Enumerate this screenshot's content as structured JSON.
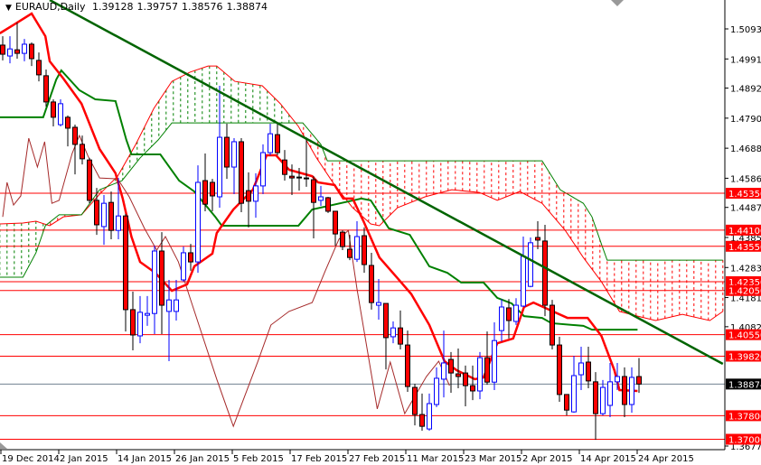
{
  "header": {
    "menu_icon": "triangle-down-icon",
    "symbol": "EURAUD,Daily",
    "open": "1.39128",
    "high": "1.39757",
    "low": "1.38576",
    "close": "1.38874"
  },
  "colors": {
    "bull": "#0000ff",
    "bear": "#ff0000",
    "tenkan": "#ff0000",
    "kijun": "#008000",
    "chikou": "#a52a2a",
    "level": "#ff0000",
    "trendline": "#006400",
    "current": "#708090"
  },
  "chart_data": {
    "type": "candlestick",
    "title": "EURAUD,Daily",
    "x_ticks": [
      {
        "bar": 0,
        "label": "19 Dec 2014"
      },
      {
        "bar": 8,
        "label": "2 Jan 2015"
      },
      {
        "bar": 16,
        "label": "14 Jan 2015"
      },
      {
        "bar": 24,
        "label": "26 Jan 2015"
      },
      {
        "bar": 32,
        "label": "5 Feb 2015"
      },
      {
        "bar": 40,
        "label": "17 Feb 2015"
      },
      {
        "bar": 48,
        "label": "27 Feb 2015"
      },
      {
        "bar": 56,
        "label": "11 Mar 2015"
      },
      {
        "bar": 64,
        "label": "23 Mar 2015"
      },
      {
        "bar": 72,
        "label": "2 Apr 2015"
      },
      {
        "bar": 80,
        "label": "14 Apr 2015"
      },
      {
        "bar": 88,
        "label": "24 Apr 2015"
      }
    ],
    "y_ticks": [
      "1.50930",
      "1.49910",
      "1.48920",
      "1.47900",
      "1.46880",
      "1.45860",
      "1.44870",
      "1.43850",
      "1.42830",
      "1.41810",
      "1.40820",
      "1.36770"
    ],
    "ylim": [
      1.3677,
      1.5093
    ],
    "levels": [
      "1.45350",
      "1.44100",
      "1.43550",
      "1.42350",
      "1.42050",
      "1.40550",
      "1.39820",
      "1.37800",
      "1.37000"
    ],
    "current_price": "1.38874",
    "candles": [
      [
        1.5038,
        1.5068,
        1.4986,
        1.5007
      ],
      [
        1.5001,
        1.5068,
        1.4976,
        1.5025
      ],
      [
        1.5022,
        1.5114,
        1.4992,
        1.501
      ],
      [
        1.501,
        1.5059,
        1.4983,
        1.5041
      ],
      [
        1.5041,
        1.5047,
        1.4967,
        1.4992
      ],
      [
        1.4986,
        1.5013,
        1.4915,
        1.4937
      ],
      [
        1.4934,
        1.4955,
        1.4829,
        1.4845
      ],
      [
        1.4845,
        1.4854,
        1.4762,
        1.4793
      ],
      [
        1.4768,
        1.4854,
        1.4762,
        1.4839
      ],
      [
        1.4793,
        1.4799,
        1.4694,
        1.4756
      ],
      [
        1.4759,
        1.4768,
        1.4599,
        1.4701
      ],
      [
        1.4701,
        1.4731,
        1.4633,
        1.4652
      ],
      [
        1.4648,
        1.4655,
        1.4501,
        1.4511
      ],
      [
        1.4511,
        1.4553,
        1.4394,
        1.4428
      ],
      [
        1.4422,
        1.4529,
        1.436,
        1.4501
      ],
      [
        1.4504,
        1.4541,
        1.4379,
        1.4409
      ],
      [
        1.4409,
        1.4587,
        1.4379,
        1.4458
      ],
      [
        1.4458,
        1.4465,
        1.4066,
        1.414
      ],
      [
        1.414,
        1.4201,
        1.4002,
        1.4054
      ],
      [
        1.4051,
        1.4186,
        1.4026,
        1.4131
      ],
      [
        1.4121,
        1.4186,
        1.4085,
        1.4127
      ],
      [
        1.4127,
        1.4357,
        1.4057,
        1.4339
      ],
      [
        1.4339,
        1.4403,
        1.4057,
        1.4155
      ],
      [
        1.4134,
        1.4241,
        1.3965,
        1.4173
      ],
      [
        1.4134,
        1.4241,
        1.4103,
        1.4173
      ],
      [
        1.4241,
        1.4354,
        1.4235,
        1.4333
      ],
      [
        1.4333,
        1.4363,
        1.4272,
        1.4302
      ],
      [
        1.4302,
        1.463,
        1.4265,
        1.4572
      ],
      [
        1.4578,
        1.467,
        1.4474,
        1.4498
      ],
      [
        1.4572,
        1.4584,
        1.4474,
        1.4526
      ],
      [
        1.4523,
        1.49,
        1.4486,
        1.4725
      ],
      [
        1.4725,
        1.4771,
        1.4584,
        1.4624
      ],
      [
        1.4624,
        1.4722,
        1.4532,
        1.471
      ],
      [
        1.471,
        1.4722,
        1.4471,
        1.4501
      ],
      [
        1.4544,
        1.4606,
        1.4419,
        1.4508
      ],
      [
        1.4508,
        1.4603,
        1.4452,
        1.456
      ],
      [
        1.456,
        1.4701,
        1.4532,
        1.4673
      ],
      [
        1.4673,
        1.4771,
        1.4664,
        1.4737
      ],
      [
        1.4734,
        1.4771,
        1.4664,
        1.4673
      ],
      [
        1.4648,
        1.4682,
        1.4578,
        1.4599
      ],
      [
        1.4593,
        1.4633,
        1.4529,
        1.4587
      ],
      [
        1.459,
        1.4621,
        1.4544,
        1.4587
      ],
      [
        1.4587,
        1.4725,
        1.4557,
        1.4584
      ],
      [
        1.4581,
        1.4593,
        1.4382,
        1.4504
      ],
      [
        1.4511,
        1.456,
        1.4492,
        1.4523
      ],
      [
        1.452,
        1.4523,
        1.4468,
        1.4474
      ],
      [
        1.4474,
        1.4474,
        1.4357,
        1.4397
      ],
      [
        1.4403,
        1.4409,
        1.4342,
        1.4354
      ],
      [
        1.4345,
        1.4394,
        1.4308,
        1.4317
      ],
      [
        1.4311,
        1.444,
        1.4302,
        1.4388
      ],
      [
        1.4391,
        1.4419,
        1.4265,
        1.4293
      ],
      [
        1.429,
        1.4333,
        1.414,
        1.4164
      ],
      [
        1.4155,
        1.4244,
        1.4106,
        1.4164
      ],
      [
        1.4161,
        1.4161,
        1.3937,
        1.4045
      ],
      [
        1.4048,
        1.41,
        1.4026,
        1.4078
      ],
      [
        1.4078,
        1.4137,
        1.4005,
        1.4023
      ],
      [
        1.402,
        1.4069,
        1.3861,
        1.3879
      ],
      [
        1.3876,
        1.3888,
        1.3747,
        1.3784
      ],
      [
        1.3784,
        1.3855,
        1.3729,
        1.3744
      ],
      [
        1.3735,
        1.3855,
        1.3729,
        1.3821
      ],
      [
        1.3818,
        1.3944,
        1.3809,
        1.3907
      ],
      [
        1.3904,
        1.4069,
        1.3842,
        1.3959
      ],
      [
        1.3971,
        1.3996,
        1.3858,
        1.3925
      ],
      [
        1.3922,
        1.4008,
        1.3873,
        1.3913
      ],
      [
        1.3925,
        1.395,
        1.3812,
        1.3882
      ],
      [
        1.3882,
        1.395,
        1.3833,
        1.3864
      ],
      [
        1.3864,
        1.3996,
        1.3836,
        1.3977
      ],
      [
        1.3977,
        1.4066,
        1.3885,
        1.3894
      ],
      [
        1.3894,
        1.4097,
        1.3867,
        1.4035
      ],
      [
        1.4069,
        1.4176,
        1.4032,
        1.4149
      ],
      [
        1.4146,
        1.4176,
        1.4042,
        1.4103
      ],
      [
        1.41,
        1.4179,
        1.4088,
        1.4155
      ],
      [
        1.4152,
        1.4388,
        1.4149,
        1.4321
      ],
      [
        1.4219,
        1.4385,
        1.4216,
        1.4367
      ],
      [
        1.4385,
        1.444,
        1.4345,
        1.4376
      ],
      [
        1.4373,
        1.4428,
        1.4118,
        1.4155
      ],
      [
        1.4155,
        1.4173,
        1.4005,
        1.402
      ],
      [
        1.402,
        1.4048,
        1.3827,
        1.3852
      ],
      [
        1.3852,
        1.3852,
        1.3781,
        1.3799
      ],
      [
        1.3793,
        1.3983,
        1.379,
        1.3916
      ],
      [
        1.3919,
        1.4014,
        1.3867,
        1.3959
      ],
      [
        1.3962,
        1.4014,
        1.3873,
        1.3898
      ],
      [
        1.3895,
        1.3928,
        1.3698,
        1.3787
      ],
      [
        1.3787,
        1.3901,
        1.3781,
        1.3876
      ],
      [
        1.3815,
        1.3959,
        1.3775,
        1.3895
      ],
      [
        1.3895,
        1.3959,
        1.3867,
        1.3913
      ],
      [
        1.3913,
        1.3944,
        1.3775,
        1.3818
      ],
      [
        1.3818,
        1.3944,
        1.379,
        1.391
      ],
      [
        1.39128,
        1.39757,
        1.38576,
        1.38874
      ]
    ],
    "ichimoku": {
      "tenkan": [
        [
          -0.4,
          1.5078
        ],
        [
          1.6,
          1.5108
        ],
        [
          4,
          1.5145
        ],
        [
          5.9,
          1.5068
        ],
        [
          6.5,
          1.4983
        ],
        [
          8.4,
          1.4924
        ],
        [
          10.9,
          1.4839
        ],
        [
          13.4,
          1.4685
        ],
        [
          15.6,
          1.4603
        ],
        [
          16.6,
          1.4517
        ],
        [
          17.8,
          1.4388
        ],
        [
          19,
          1.4302
        ],
        [
          21.1,
          1.4265
        ],
        [
          23.4,
          1.4204
        ],
        [
          25.5,
          1.4226
        ],
        [
          26.5,
          1.4287
        ],
        [
          29,
          1.433
        ],
        [
          29.6,
          1.44
        ],
        [
          31.9,
          1.448
        ],
        [
          34.6,
          1.4547
        ],
        [
          36.5,
          1.4664
        ],
        [
          37.8,
          1.4664
        ],
        [
          39.6,
          1.4615
        ],
        [
          42.8,
          1.4593
        ],
        [
          43.6,
          1.4572
        ],
        [
          45.9,
          1.4563
        ],
        [
          47.1,
          1.4517
        ],
        [
          48.4,
          1.4517
        ],
        [
          49.9,
          1.444
        ],
        [
          52.1,
          1.4317
        ],
        [
          54.6,
          1.4247
        ],
        [
          56.5,
          1.4193
        ],
        [
          59,
          1.4088
        ],
        [
          61.1,
          1.3965
        ],
        [
          62.8,
          1.3934
        ],
        [
          65.3,
          1.3904
        ],
        [
          66.5,
          1.391
        ],
        [
          68.4,
          1.4026
        ],
        [
          70.6,
          1.4042
        ],
        [
          72.1,
          1.4149
        ],
        [
          73.4,
          1.4164
        ],
        [
          76.1,
          1.4134
        ],
        [
          78.1,
          1.4112
        ],
        [
          80.9,
          1.4112
        ],
        [
          82.8,
          1.4051
        ],
        [
          84.6,
          1.3934
        ],
        [
          85.3,
          1.3867
        ],
        [
          87.8,
          1.3864
        ]
      ],
      "kijun": [
        [
          -0.4,
          1.4793
        ],
        [
          5.6,
          1.4793
        ],
        [
          7.4,
          1.4921
        ],
        [
          8.1,
          1.4952
        ],
        [
          10.6,
          1.4885
        ],
        [
          12.8,
          1.4854
        ],
        [
          15.6,
          1.4848
        ],
        [
          17.1,
          1.4716
        ],
        [
          17.8,
          1.4667
        ],
        [
          21.8,
          1.4667
        ],
        [
          24.4,
          1.4578
        ],
        [
          26.5,
          1.4541
        ],
        [
          29.4,
          1.4455
        ],
        [
          30.3,
          1.4425
        ],
        [
          40.9,
          1.4425
        ],
        [
          42.8,
          1.448
        ],
        [
          49.6,
          1.4517
        ],
        [
          50.9,
          1.4511
        ],
        [
          53.4,
          1.4416
        ],
        [
          56.3,
          1.4394
        ],
        [
          59,
          1.4287
        ],
        [
          61.5,
          1.4265
        ],
        [
          63.4,
          1.4232
        ],
        [
          66.5,
          1.4232
        ],
        [
          68.4,
          1.418
        ],
        [
          70.4,
          1.4161
        ],
        [
          72.1,
          1.4118
        ],
        [
          74.6,
          1.4112
        ],
        [
          75.9,
          1.4094
        ],
        [
          80.3,
          1.4085
        ],
        [
          81.5,
          1.4072
        ],
        [
          87.8,
          1.4072
        ]
      ],
      "chikou": [
        [
          0,
          1.4455
        ],
        [
          0.6,
          1.4572
        ],
        [
          1.5,
          1.4495
        ],
        [
          2.5,
          1.4526
        ],
        [
          3.6,
          1.4722
        ],
        [
          4.8,
          1.4624
        ],
        [
          5.8,
          1.471
        ],
        [
          6.8,
          1.4501
        ],
        [
          7.8,
          1.4511
        ],
        [
          9.6,
          1.467
        ],
        [
          10.6,
          1.4731
        ],
        [
          11.8,
          1.4661
        ],
        [
          13.4,
          1.4587
        ],
        [
          15.9,
          1.4584
        ],
        [
          17.5,
          1.4523
        ],
        [
          19.6,
          1.4416
        ],
        [
          21.3,
          1.4342
        ],
        [
          22.5,
          1.4388
        ],
        [
          24.3,
          1.4302
        ],
        [
          25.9,
          1.418
        ],
        [
          29.6,
          1.3904
        ],
        [
          31.9,
          1.3744
        ],
        [
          33.4,
          1.3842
        ],
        [
          35.3,
          1.3965
        ],
        [
          37.1,
          1.4088
        ],
        [
          39.6,
          1.4134
        ],
        [
          42.8,
          1.4164
        ],
        [
          44.6,
          1.4271
        ],
        [
          46.5,
          1.4379
        ],
        [
          47.8,
          1.4409
        ],
        [
          49,
          1.421
        ],
        [
          51.8,
          1.3803
        ],
        [
          53.6,
          1.3962
        ],
        [
          55.6,
          1.3787
        ],
        [
          58.6,
          1.3913
        ],
        [
          60.3,
          1.3965
        ],
        [
          61.8,
          1.3882
        ]
      ],
      "span_a": [
        [
          -0.4,
          1.4431
        ],
        [
          2.8,
          1.4434
        ],
        [
          4.6,
          1.444
        ],
        [
          6.5,
          1.4425
        ],
        [
          8.4,
          1.4455
        ],
        [
          10.9,
          1.4462
        ],
        [
          13.4,
          1.4532
        ],
        [
          15.9,
          1.4593
        ],
        [
          18.4,
          1.4701
        ],
        [
          20.9,
          1.4823
        ],
        [
          23.4,
          1.4915
        ],
        [
          25.9,
          1.4946
        ],
        [
          28.4,
          1.4967
        ],
        [
          29.6,
          1.4967
        ],
        [
          32.1,
          1.4915
        ],
        [
          35.9,
          1.49
        ],
        [
          38.4,
          1.4839
        ],
        [
          40.9,
          1.4762
        ],
        [
          43.4,
          1.4655
        ],
        [
          45.9,
          1.4563
        ],
        [
          48.4,
          1.4486
        ],
        [
          50.9,
          1.4431
        ],
        [
          52.1,
          1.4425
        ],
        [
          54.6,
          1.4486
        ],
        [
          58.4,
          1.4523
        ],
        [
          62.1,
          1.4547
        ],
        [
          65.9,
          1.4538
        ],
        [
          68.4,
          1.4511
        ],
        [
          71.5,
          1.4541
        ],
        [
          74.6,
          1.4501
        ],
        [
          77.8,
          1.4409
        ],
        [
          80.3,
          1.4317
        ],
        [
          82.8,
          1.4235
        ],
        [
          85.3,
          1.4134
        ],
        [
          87.8,
          1.4118
        ],
        [
          90.3,
          1.4103
        ],
        [
          94,
          1.4124
        ],
        [
          97.8,
          1.4103
        ],
        [
          99.6,
          1.4134
        ]
      ],
      "span_b": [
        [
          -0.4,
          1.425
        ],
        [
          2.8,
          1.425
        ],
        [
          4.6,
          1.4333
        ],
        [
          5.9,
          1.4425
        ],
        [
          7.8,
          1.4462
        ],
        [
          10.9,
          1.4462
        ],
        [
          13.4,
          1.4547
        ],
        [
          16.5,
          1.4578
        ],
        [
          19,
          1.4655
        ],
        [
          21.5,
          1.4716
        ],
        [
          23.4,
          1.4774
        ],
        [
          41.5,
          1.4774
        ],
        [
          44,
          1.4701
        ],
        [
          44.9,
          1.4645
        ],
        [
          74.6,
          1.4645
        ],
        [
          77.1,
          1.4547
        ],
        [
          80.3,
          1.4501
        ],
        [
          81.5,
          1.4455
        ],
        [
          82.8,
          1.4363
        ],
        [
          83.6,
          1.4308
        ],
        [
          99.6,
          1.4308
        ]
      ]
    },
    "trendline": [
      [
        6.5,
        1.5191
      ],
      [
        99.6,
        1.3956
      ]
    ]
  }
}
